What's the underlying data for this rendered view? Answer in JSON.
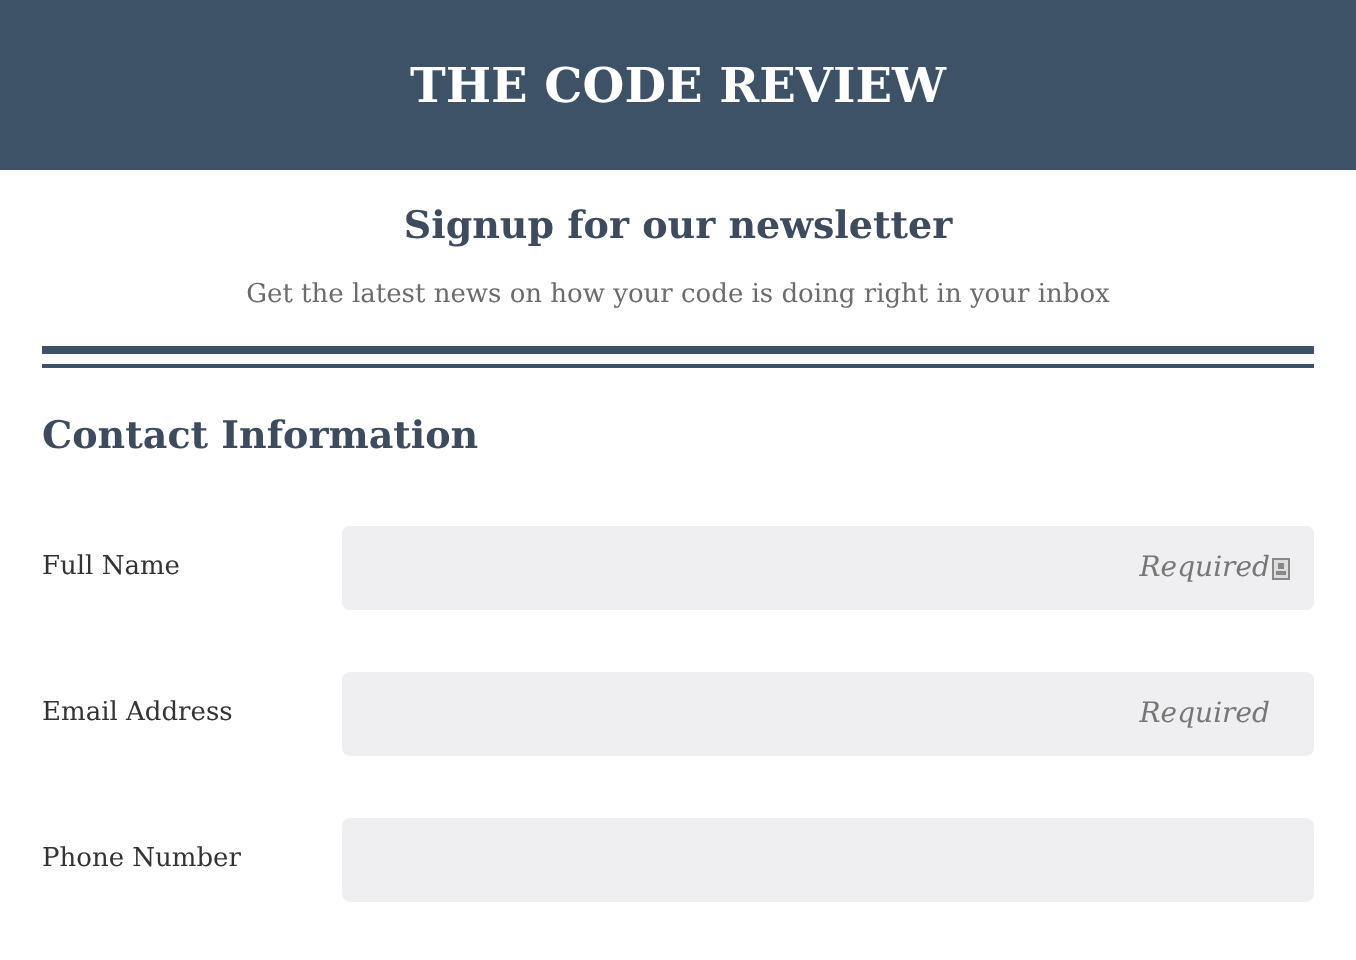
{
  "header": {
    "title": "THE CODE REVIEW"
  },
  "intro": {
    "heading": "Signup for our newsletter",
    "text": "Get the latest news on how your code is doing right in your inbox"
  },
  "section": {
    "title": "Contact Information"
  },
  "fields": [
    {
      "label": "Full Name",
      "placeholder": "Required",
      "autofill_icon": true
    },
    {
      "label": "Email Address",
      "placeholder": "Required",
      "autofill_icon": false
    },
    {
      "label": "Phone Number",
      "autofill_icon": false
    }
  ]
}
